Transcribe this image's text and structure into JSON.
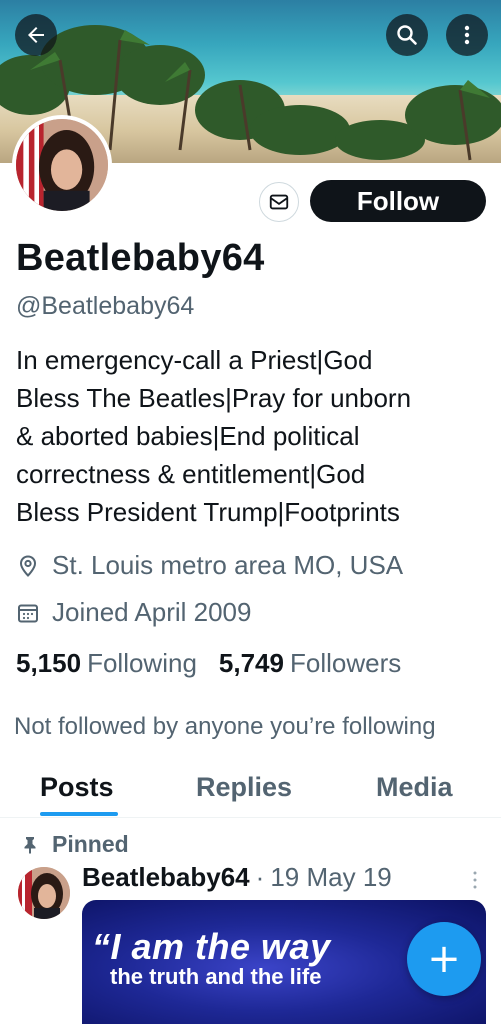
{
  "header": {
    "back_icon": "arrow-left-icon",
    "search_icon": "search-icon",
    "more_icon": "more-vertical-icon"
  },
  "profile": {
    "display_name": "Beatlebaby64",
    "handle": "@Beatlebaby64",
    "bio_lines": [
      "In emergency-call a Priest|God",
      "Bless The Beatles|Pray for unborn",
      "& aborted babies|End political",
      "correctness & entitlement|God",
      "Bless President Trump|Footprints"
    ],
    "location": "St. Louis metro area MO, USA",
    "joined": "Joined April 2009",
    "following_count": "5,150",
    "following_label": "Following",
    "followers_count": "5,749",
    "followers_label": "Followers",
    "not_followed_text": "Not followed by anyone you’re following",
    "follow_label": "Follow"
  },
  "tabs": [
    {
      "label": "Posts",
      "active": true
    },
    {
      "label": "Replies",
      "active": false
    },
    {
      "label": "Media",
      "active": false
    }
  ],
  "post": {
    "pinned_label": "Pinned",
    "author": "Beatlebaby64",
    "separator": "·",
    "date": "19 May 19",
    "image_text_line1": "“I am the way",
    "image_text_line2": "the truth and the life"
  },
  "fab": {
    "label": "+"
  },
  "colors": {
    "accent": "#1d9bf0",
    "text_primary": "#0f1419",
    "text_secondary": "#536471",
    "follow_button_bg": "#0f1419"
  }
}
